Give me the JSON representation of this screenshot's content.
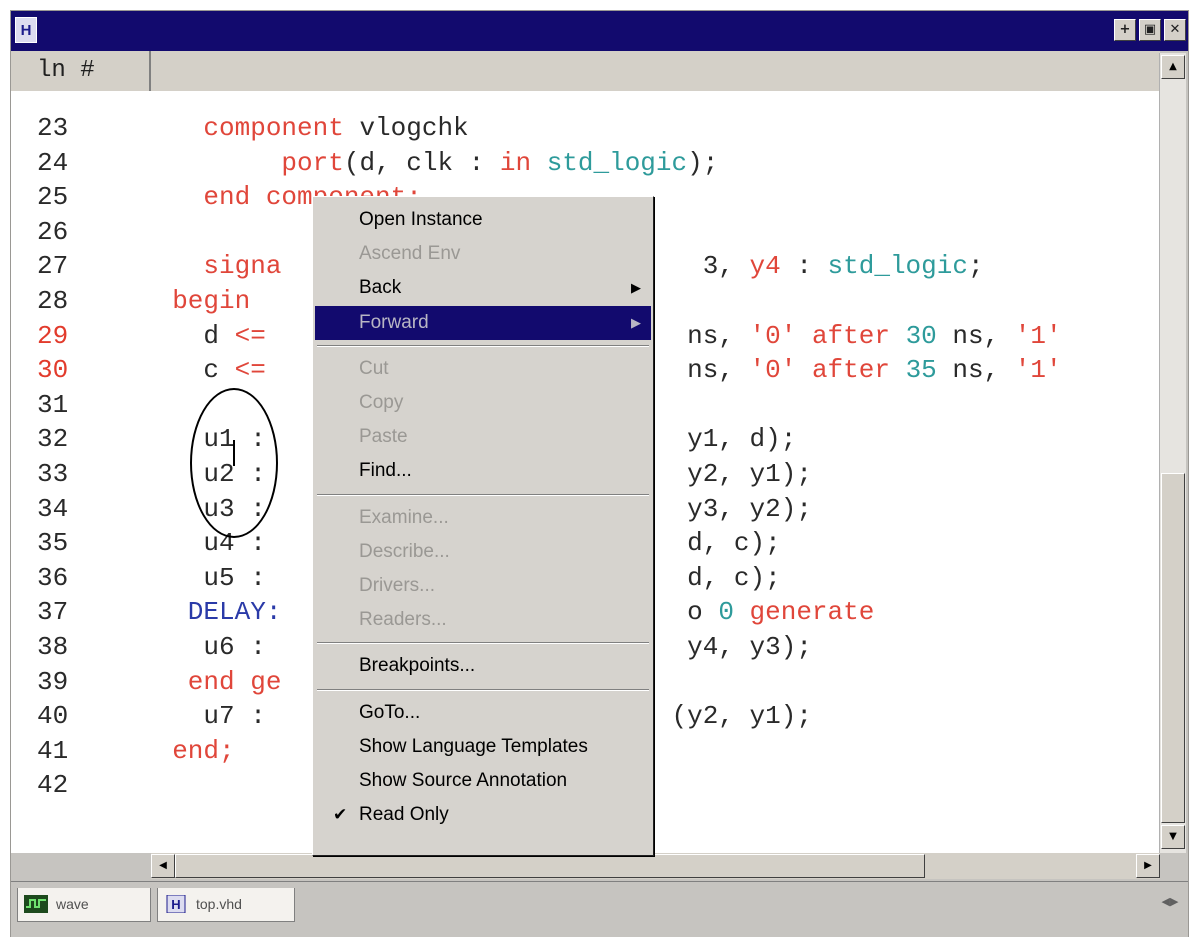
{
  "window": {
    "icon_letter": "H",
    "buttons": [
      "+",
      "▣",
      "✕"
    ]
  },
  "header": {
    "line_number_label": "ln #"
  },
  "editor": {
    "lines": [
      {
        "n": "23",
        "err": false,
        "t": [
          [
            "    component ",
            "kw"
          ],
          [
            "vlogchk",
            "id"
          ]
        ]
      },
      {
        "n": "24",
        "err": false,
        "t": [
          [
            "         port",
            "kw"
          ],
          [
            "(d, clk : ",
            "id"
          ],
          [
            "in ",
            "kw"
          ],
          [
            "std_logic",
            "ty"
          ],
          [
            ");",
            "pu"
          ]
        ]
      },
      {
        "n": "25",
        "err": false,
        "t": [
          [
            "    end component;",
            "kw"
          ]
        ]
      },
      {
        "n": "26",
        "err": false,
        "t": [
          [
            "",
            "id"
          ]
        ]
      },
      {
        "n": "27",
        "err": false,
        "t": [
          [
            "    signa",
            "kw"
          ],
          [
            "                           3, ",
            "id"
          ],
          [
            "y4",
            "kw"
          ],
          [
            " : ",
            "id"
          ],
          [
            "std_logic",
            "ty"
          ],
          [
            ";",
            "pu"
          ]
        ]
      },
      {
        "n": "28",
        "err": false,
        "t": [
          [
            "  begin",
            "kw"
          ]
        ]
      },
      {
        "n": "29",
        "err": true,
        "t": [
          [
            "    d ",
            "id"
          ],
          [
            "<=",
            "kw"
          ],
          [
            "                           ns, ",
            "id"
          ],
          [
            "'0'",
            "kw"
          ],
          [
            " after ",
            "kw"
          ],
          [
            "30",
            "nm"
          ],
          [
            " ns, ",
            "id"
          ],
          [
            "'1'",
            "kw"
          ]
        ]
      },
      {
        "n": "30",
        "err": true,
        "t": [
          [
            "    c ",
            "id"
          ],
          [
            "<=",
            "kw"
          ],
          [
            "                           ns, ",
            "id"
          ],
          [
            "'0'",
            "kw"
          ],
          [
            " after ",
            "kw"
          ],
          [
            "35",
            "nm"
          ],
          [
            " ns, ",
            "id"
          ],
          [
            "'1'",
            "kw"
          ]
        ]
      },
      {
        "n": "31",
        "err": false,
        "t": [
          [
            "",
            "id"
          ]
        ]
      },
      {
        "n": "32",
        "err": false,
        "t": [
          [
            "    u1 :",
            "id"
          ],
          [
            "                           y1, d);",
            "id"
          ]
        ]
      },
      {
        "n": "33",
        "err": false,
        "t": [
          [
            "    u2 :",
            "id"
          ],
          [
            "                           y2, y1);",
            "id"
          ]
        ]
      },
      {
        "n": "34",
        "err": false,
        "t": [
          [
            "    u3 :",
            "id"
          ],
          [
            "                           y3, y2);",
            "id"
          ]
        ]
      },
      {
        "n": "35",
        "err": false,
        "t": [
          [
            "    u4 :",
            "id"
          ],
          [
            "                           d, c);",
            "id"
          ]
        ]
      },
      {
        "n": "36",
        "err": false,
        "t": [
          [
            "    u5 :",
            "id"
          ],
          [
            "                           d, c);",
            "id"
          ]
        ]
      },
      {
        "n": "37",
        "err": false,
        "t": [
          [
            "   DELAY:",
            "bl"
          ],
          [
            "                          o ",
            "id"
          ],
          [
            "0",
            "nm"
          ],
          [
            " generate",
            "kw"
          ]
        ]
      },
      {
        "n": "38",
        "err": false,
        "t": [
          [
            "    u6 :",
            "id"
          ],
          [
            "                           y4, y3);",
            "id"
          ]
        ]
      },
      {
        "n": "39",
        "err": false,
        "t": [
          [
            "   end ge",
            "kw"
          ]
        ]
      },
      {
        "n": "40",
        "err": false,
        "t": [
          [
            "    u7 :",
            "id"
          ],
          [
            "                          (y2, y1);",
            "id"
          ]
        ]
      },
      {
        "n": "41",
        "err": false,
        "t": [
          [
            "  end;",
            "kw"
          ]
        ]
      },
      {
        "n": "42",
        "err": false,
        "t": [
          [
            "",
            "id"
          ]
        ]
      }
    ]
  },
  "context_menu": {
    "items": [
      {
        "label": "Open Instance",
        "enabled": true
      },
      {
        "label": "Ascend Env",
        "enabled": false
      },
      {
        "label": "Back",
        "enabled": true,
        "submenu": true
      },
      {
        "label": "Forward",
        "enabled": false,
        "submenu": true,
        "highlighted": true
      },
      {
        "separator": true
      },
      {
        "label": "Cut",
        "enabled": false
      },
      {
        "label": "Copy",
        "enabled": false
      },
      {
        "label": "Paste",
        "enabled": false
      },
      {
        "label": "Find...",
        "enabled": true
      },
      {
        "separator": true
      },
      {
        "label": "Examine...",
        "enabled": false
      },
      {
        "label": "Describe...",
        "enabled": false
      },
      {
        "label": "Drivers...",
        "enabled": false
      },
      {
        "label": "Readers...",
        "enabled": false
      },
      {
        "separator": true
      },
      {
        "label": "Breakpoints...",
        "enabled": true
      },
      {
        "separator": true
      },
      {
        "label": "GoTo...",
        "enabled": true
      },
      {
        "label": "Show Language Templates",
        "enabled": true
      },
      {
        "label": "Show Source Annotation",
        "enabled": true
      },
      {
        "label": "Read Only",
        "enabled": true,
        "checked": true
      }
    ]
  },
  "tabs": [
    {
      "label": "wave",
      "icon": "wave-icon"
    },
    {
      "label": "top.vhd",
      "icon": "vhdl-file-icon"
    }
  ],
  "scroll": {
    "up_arrow": "▲",
    "down_arrow": "▼",
    "left_arrow": "◀",
    "right_arrow": "▶"
  },
  "tab_nav": "◀▶"
}
